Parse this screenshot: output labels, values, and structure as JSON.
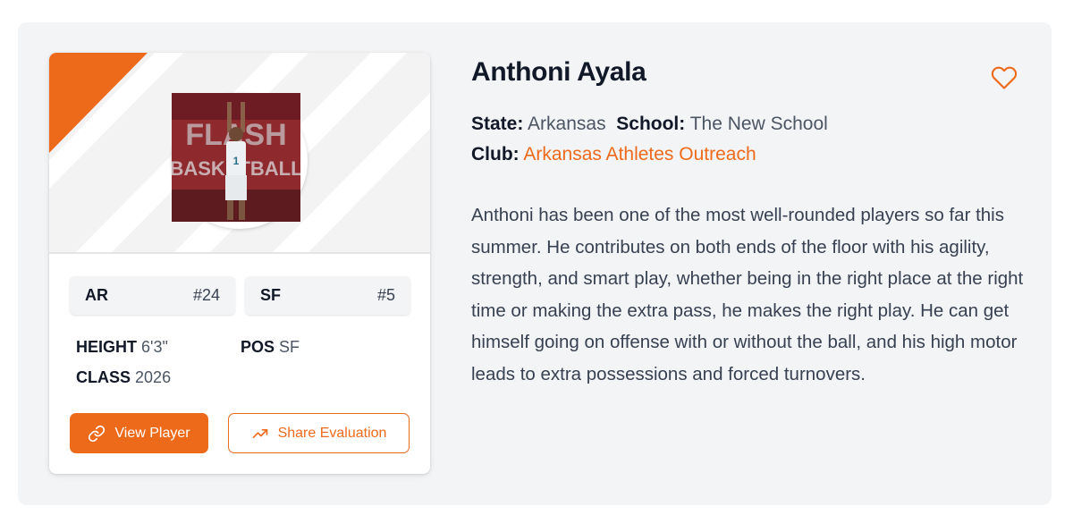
{
  "player": {
    "name": "Anthoni Ayala",
    "state_label": "State:",
    "state": "Arkansas",
    "school_label": "School:",
    "school": "The New School",
    "club_label": "Club:",
    "club": "Arkansas Athletes Outreach",
    "bio": "Anthoni has been one of the most well-rounded players so far this summer. He contributes on both ends of the floor with his agility, strength, and smart play, whether being in the right place at the right time or making the extra pass, he makes the right play. He can get himself going on offense with or without the ball, and his high motor leads to extra possessions and forced turnovers."
  },
  "card": {
    "state_tag": {
      "label": "AR",
      "rank": "#24"
    },
    "position_tag": {
      "label": "SF",
      "rank": "#5"
    },
    "height_label": "HEIGHT",
    "height": "6'3\"",
    "pos_label": "POS",
    "pos": "SF",
    "class_label": "CLASS",
    "class": "2026",
    "photo_logo_text": "FLASH",
    "photo_logo_sub": "BASKETBALL",
    "jersey_number": "1"
  },
  "buttons": {
    "view_player": "View Player",
    "share_evaluation": "Share Evaluation"
  },
  "icons": {
    "favorite": "heart-icon",
    "view": "link-icon",
    "share": "trending-up-icon"
  },
  "colors": {
    "accent": "#ee6a1b",
    "background": "#f3f4f6",
    "text": "#111827"
  }
}
